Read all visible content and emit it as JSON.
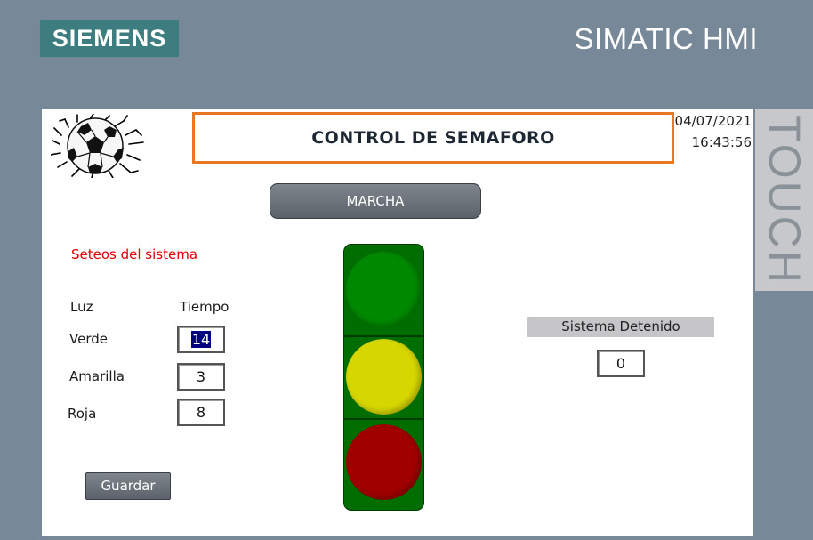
{
  "header": {
    "brand": "SIEMENS",
    "product": "SIMATIC HMI",
    "side_label": "TOUCH"
  },
  "screen": {
    "title": "CONTROL DE SEMAFORO",
    "date": "04/07/2021",
    "time": "16:43:56",
    "start_button": "MARCHA",
    "settings": {
      "title": "Seteos del sistema",
      "col_light": "Luz",
      "col_time": "Tiempo",
      "rows": [
        {
          "label": "Verde",
          "value": "14"
        },
        {
          "label": "Amarilla",
          "value": "3"
        },
        {
          "label": "Roja",
          "value": "8"
        }
      ],
      "save_button": "Guardar"
    },
    "traffic_light": {
      "top_color": "#008800",
      "middle_color": "#d6d600",
      "bottom_color": "#a00000"
    },
    "status": {
      "label": "Sistema Detenido",
      "value": "0"
    }
  },
  "colors": {
    "frame": "#778899",
    "brand_bg": "#3d7d7f",
    "title_border": "#e87722",
    "settings_title": "#e00000"
  }
}
